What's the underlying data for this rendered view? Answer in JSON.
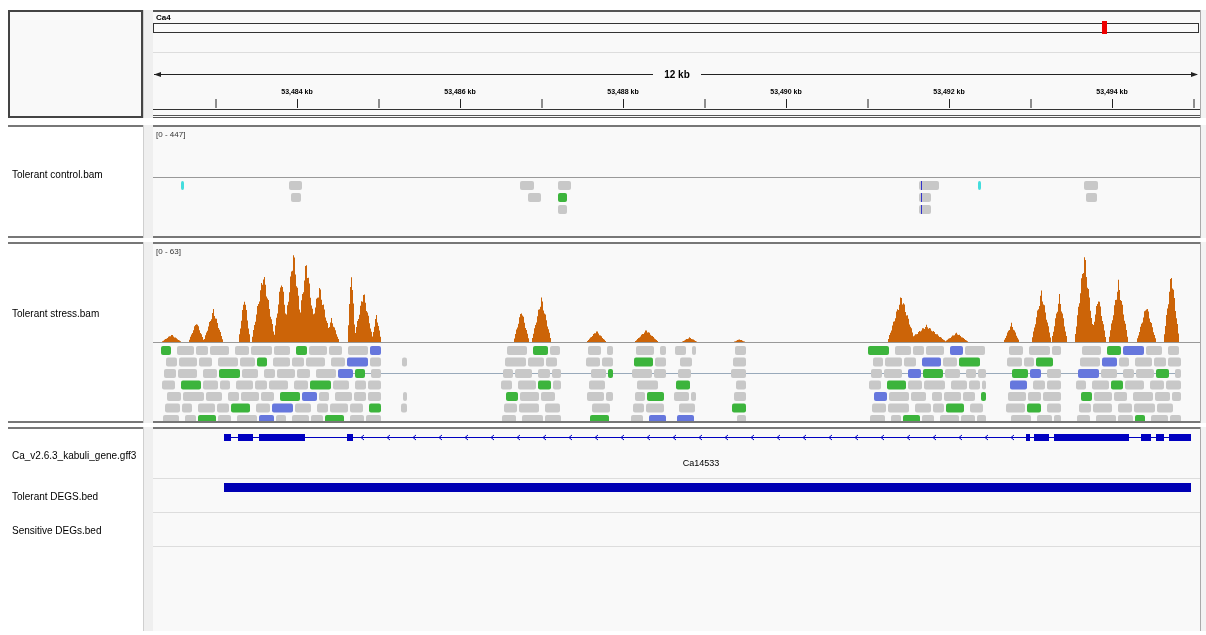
{
  "ruler": {
    "chromosome": "Ca4",
    "span": "12 kb",
    "ticks": [
      "53,484 kb",
      "53,486 kb",
      "53,488 kb",
      "53,490 kb",
      "53,492 kb",
      "53,494 kb"
    ]
  },
  "alignment_tracks": [
    {
      "name": "Tolerant control.bam",
      "range": "[0 - 447]"
    },
    {
      "name": "Tolerant stress.bam",
      "range": "[0 - 63]"
    }
  ],
  "feature_tracks": [
    {
      "kind": "gene",
      "name": "Ca_v2.6.3_kabuli_gene.gff3",
      "feature_label": "Ca14533"
    },
    {
      "kind": "bed",
      "name": "Tolerant DEGS.bed"
    },
    {
      "kind": "bed",
      "name": "Sensitive DEGs.bed"
    }
  ]
}
